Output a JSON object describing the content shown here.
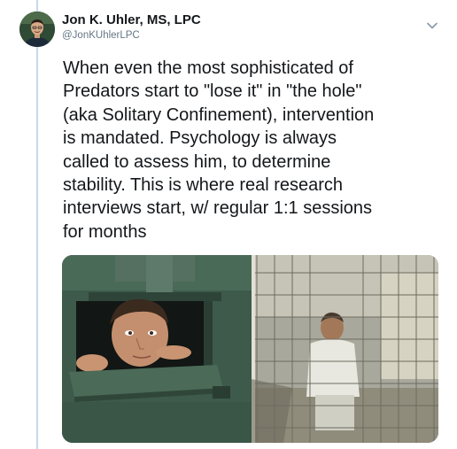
{
  "author": {
    "name": "Jon K. Uhler, MS, LPC",
    "handle": "@JonKUhlerLPC",
    "avatar_icon": "profile-photo"
  },
  "tweet": {
    "lines": [
      "When even the most sophisticated of",
      "Predators start to \"lose it\" in \"the hole\"",
      "(aka Solitary Confinement), intervention",
      "is mandated. Psychology is always",
      "called to assess him, to determine",
      "stability. This is where real research",
      "interviews start, w/ regular 1:1 sessions",
      "for months"
    ]
  },
  "menu": {
    "icon": "chevron-down-icon"
  },
  "media": {
    "left_image": "man-peering-through-cell-door-slot",
    "right_image": "inmate-in-caged-cell"
  },
  "colors": {
    "thread_line": "#c4d9ea",
    "text": "#14171a",
    "secondary": "#657786",
    "door_green": "#3f5a4b"
  }
}
